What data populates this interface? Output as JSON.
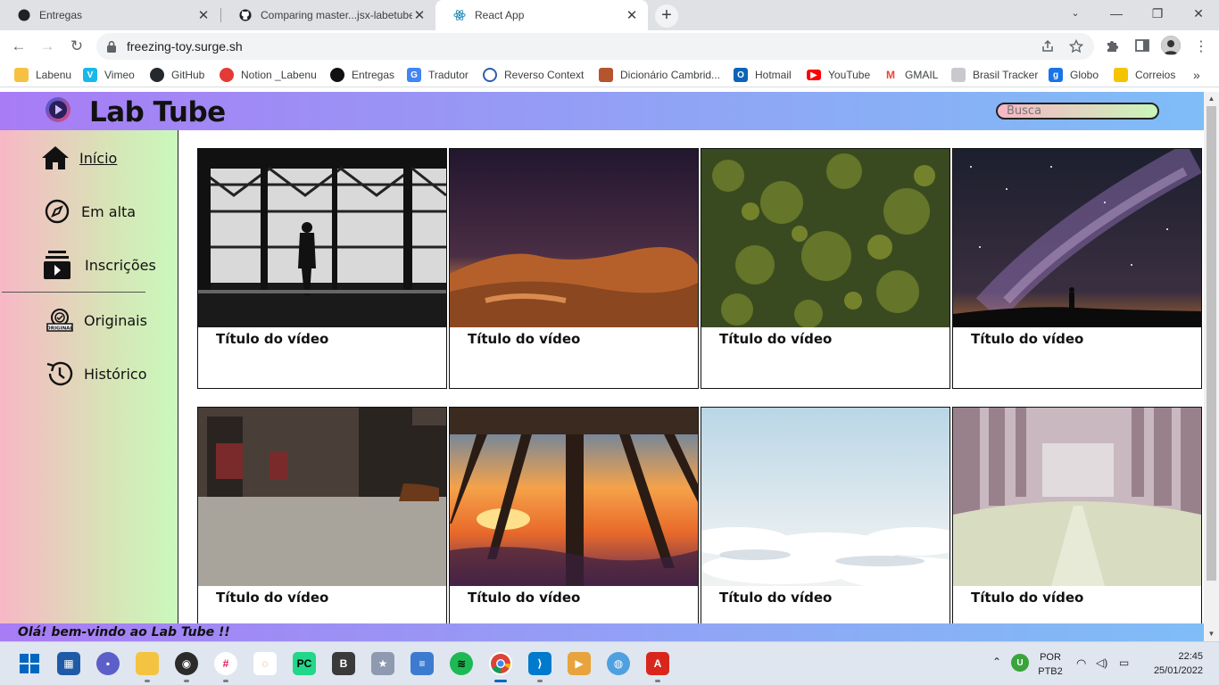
{
  "browser": {
    "tabs": [
      {
        "title": "Entregas",
        "active": false
      },
      {
        "title": "Comparing master...jsx-labetube",
        "active": false
      },
      {
        "title": "React App",
        "active": true
      }
    ],
    "url": "freezing-toy.surge.sh",
    "bookmarks": [
      {
        "label": "Labenu",
        "icon": "folder-icon",
        "color": "#f6c142"
      },
      {
        "label": "Vimeo",
        "icon": "vimeo-icon",
        "color": "#1ab7ea"
      },
      {
        "label": "GitHub",
        "icon": "github-icon",
        "color": "#24292e"
      },
      {
        "label": "Notion _Labenu",
        "icon": "apple-icon",
        "color": "#e53935"
      },
      {
        "label": "Entregas",
        "icon": "circle-icon",
        "color": "#111111"
      },
      {
        "label": "Tradutor",
        "icon": "translate-icon",
        "color": "#4285f4"
      },
      {
        "label": "Reverso Context",
        "icon": "reverso-icon",
        "color": "#2b5fad"
      },
      {
        "label": "Dicionário Cambrid...",
        "icon": "crest-icon",
        "color": "#b5542e"
      },
      {
        "label": "Hotmail",
        "icon": "outlook-icon",
        "color": "#0a64b7"
      },
      {
        "label": "YouTube",
        "icon": "youtube-icon",
        "color": "#ff0000"
      },
      {
        "label": "GMAIL",
        "icon": "gmail-icon",
        "color": "#ea4335"
      },
      {
        "label": "Brasil Tracker",
        "icon": "lock-icon",
        "color": "#9aa0a6"
      },
      {
        "label": "Globo",
        "icon": "globo-icon",
        "color": "#1a73e8"
      },
      {
        "label": "Correios",
        "icon": "correios-icon",
        "color": "#f5c400"
      }
    ]
  },
  "app": {
    "title": "Lab Tube",
    "search_placeholder": "Busca",
    "nav": [
      {
        "label": "Início",
        "icon": "home-icon",
        "active": true
      },
      {
        "label": "Em alta",
        "icon": "compass-icon",
        "active": false
      },
      {
        "label": "Inscrições",
        "icon": "subscriptions-icon",
        "active": false
      },
      {
        "label": "Originais",
        "icon": "originals-icon",
        "active": false
      },
      {
        "label": "Histórico",
        "icon": "history-icon",
        "active": false
      }
    ],
    "videos": [
      {
        "title": "Título do vídeo",
        "scene": "man-silhouette-window"
      },
      {
        "title": "Título do vídeo",
        "scene": "desert-dunes-dusk"
      },
      {
        "title": "Título do vídeo",
        "scene": "aerial-forest"
      },
      {
        "title": "Título do vídeo",
        "scene": "milky-way-night"
      },
      {
        "title": "Título do vídeo",
        "scene": "train-interior"
      },
      {
        "title": "Título do vídeo",
        "scene": "pier-sunset"
      },
      {
        "title": "Título do vídeo",
        "scene": "clouds-sky"
      },
      {
        "title": "Título do vídeo",
        "scene": "misty-road-trees"
      }
    ],
    "footer_message": "Olá! bem-vindo ao Lab Tube !!"
  },
  "taskbar": {
    "language": "POR",
    "layout": "PTB2",
    "time": "22:45",
    "date": "25/01/2022"
  }
}
